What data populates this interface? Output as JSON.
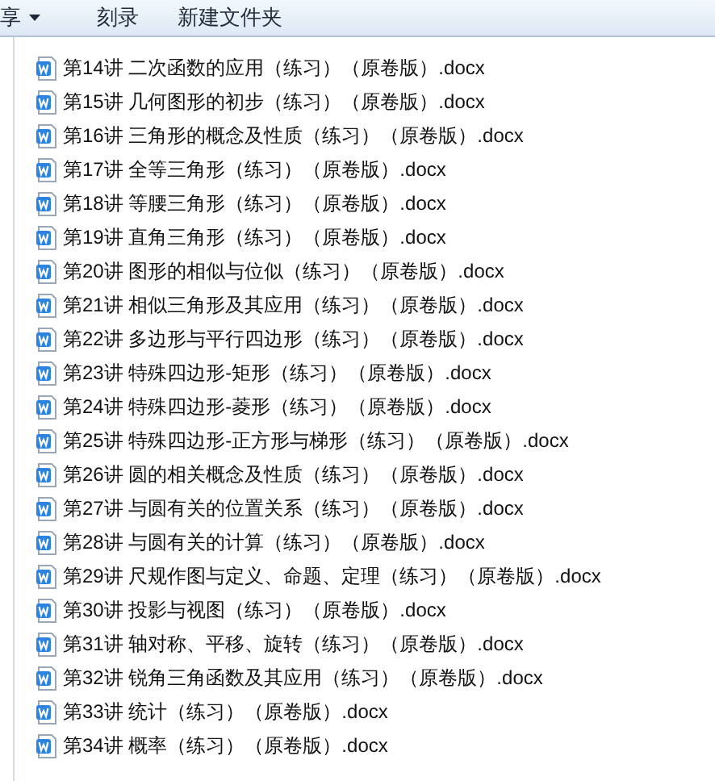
{
  "toolbar": [
    {
      "label": "享",
      "dropdown": true
    },
    {
      "label": "刻录",
      "dropdown": false
    },
    {
      "label": "新建文件夹",
      "dropdown": false
    }
  ],
  "files": [
    {
      "name": "第14讲 二次函数的应用（练习）（原卷版）.docx"
    },
    {
      "name": "第15讲 几何图形的初步（练习）（原卷版）.docx"
    },
    {
      "name": "第16讲 三角形的概念及性质（练习）（原卷版）.docx"
    },
    {
      "name": "第17讲 全等三角形（练习）（原卷版）.docx"
    },
    {
      "name": "第18讲 等腰三角形（练习）（原卷版）.docx"
    },
    {
      "name": "第19讲 直角三角形（练习）（原卷版）.docx"
    },
    {
      "name": "第20讲  图形的相似与位似（练习）（原卷版）.docx"
    },
    {
      "name": "第21讲 相似三角形及其应用（练习）（原卷版）.docx"
    },
    {
      "name": "第22讲 多边形与平行四边形（练习）（原卷版）.docx"
    },
    {
      "name": "第23讲 特殊四边形-矩形（练习）（原卷版）.docx"
    },
    {
      "name": "第24讲 特殊四边形-菱形（练习）（原卷版）.docx"
    },
    {
      "name": "第25讲 特殊四边形-正方形与梯形（练习）（原卷版）.docx"
    },
    {
      "name": "第26讲 圆的相关概念及性质（练习）（原卷版）.docx"
    },
    {
      "name": "第27讲 与圆有关的位置关系（练习）（原卷版）.docx"
    },
    {
      "name": "第28讲 与圆有关的计算（练习）（原卷版）.docx"
    },
    {
      "name": "第29讲 尺规作图与定义、命题、定理（练习）（原卷版）.docx"
    },
    {
      "name": "第30讲 投影与视图（练习）（原卷版）.docx"
    },
    {
      "name": "第31讲 轴对称、平移、旋转（练习）（原卷版）.docx"
    },
    {
      "name": "第32讲 锐角三角函数及其应用（练习）（原卷版）.docx"
    },
    {
      "name": "第33讲 统计（练习）（原卷版）.docx"
    },
    {
      "name": "第34讲  概率（练习）（原卷版）.docx"
    }
  ]
}
